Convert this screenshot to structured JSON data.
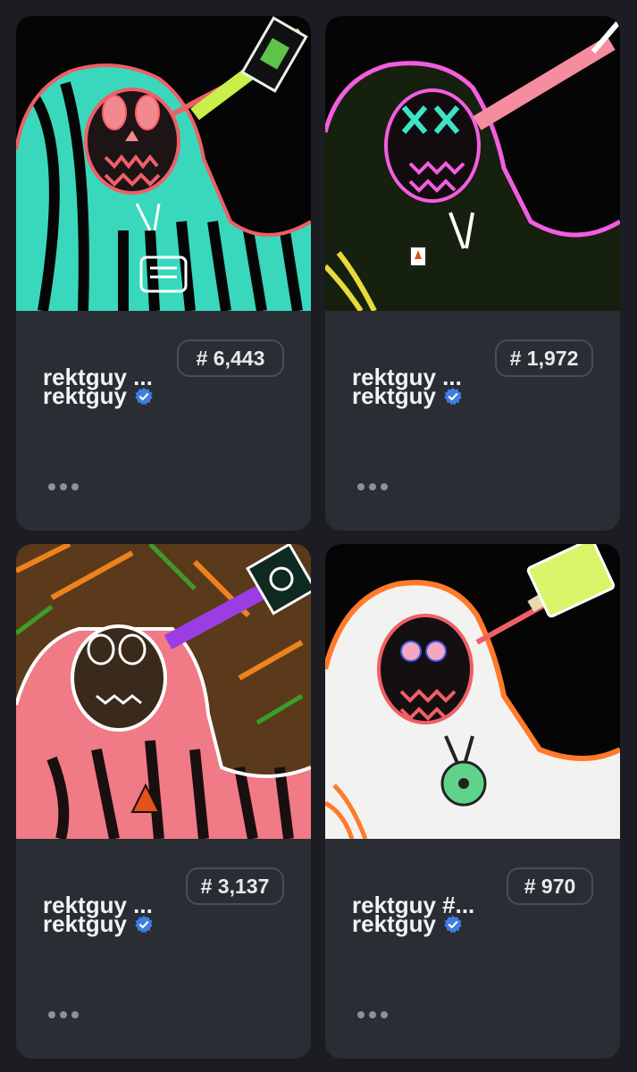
{
  "cards": [
    {
      "name": "rektguy ...",
      "token": "# 6,443",
      "collection": "rektguy"
    },
    {
      "name": "rektguy ...",
      "token": "# 1,972",
      "collection": "rektguy"
    },
    {
      "name": "rektguy ...",
      "token": "# 3,137",
      "collection": "rektguy"
    },
    {
      "name": "rektguy #...",
      "token": "# 970",
      "collection": "rektguy"
    }
  ],
  "icons": {
    "verified": "verified-badge-icon",
    "more": "more-options-icon"
  },
  "colors": {
    "background": "#1c1d22",
    "card": "#2b2d35",
    "verified": "#3d7ee0"
  }
}
